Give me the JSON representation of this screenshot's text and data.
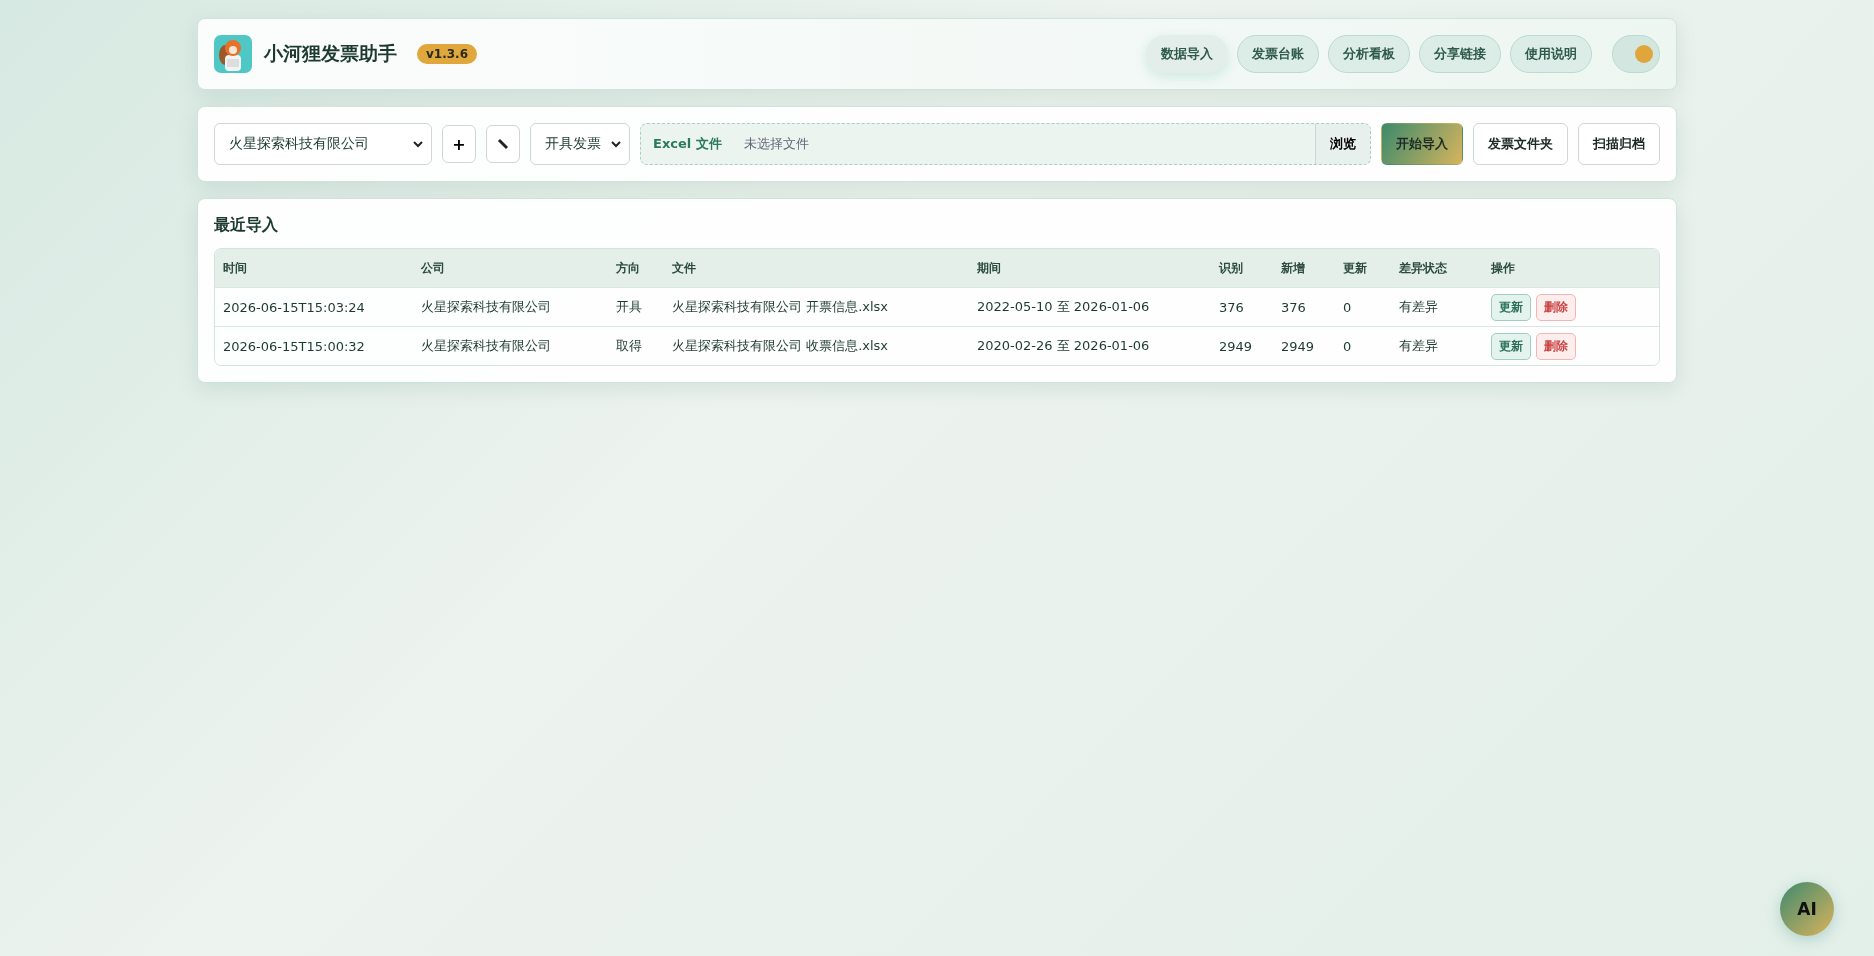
{
  "app": {
    "title": "小河狸发票助手",
    "version": "v1.3.6"
  },
  "nav": [
    {
      "label": "数据导入",
      "selected": true
    },
    {
      "label": "发票台账",
      "selected": false
    },
    {
      "label": "分析看板",
      "selected": false
    },
    {
      "label": "分享链接",
      "selected": false
    },
    {
      "label": "使用说明",
      "selected": false
    }
  ],
  "theme_toggle": {
    "on": true
  },
  "toolbar": {
    "company": "火星探索科技有限公司",
    "add": "+",
    "direction": "开具发票",
    "file_label": "Excel 文件",
    "file_placeholder": "未选择文件",
    "browse": "浏览",
    "buttons": [
      {
        "label": "开始导入",
        "kind": "primary"
      },
      {
        "label": "发票文件夹",
        "kind": "plain"
      },
      {
        "label": "扫描归档",
        "kind": "plain"
      }
    ]
  },
  "recent": {
    "title": "最近导入",
    "columns": [
      "时间",
      "公司",
      "方向",
      "文件",
      "期间",
      "识别",
      "新增",
      "更新",
      "差异状态",
      "操作"
    ],
    "rows": [
      {
        "cells": [
          "2026-06-15T15:03:24",
          "火星探索科技有限公司",
          "开具",
          "火星探索科技有限公司 开票信息.xlsx",
          "2022-05-10 至 2026-01-06",
          "376",
          "376",
          "0",
          "有差异"
        ],
        "actions": [
          {
            "label": "更新",
            "kind": "update"
          },
          {
            "label": "删除",
            "kind": "delete"
          }
        ]
      },
      {
        "cells": [
          "2026-06-15T15:00:32",
          "火星探索科技有限公司",
          "取得",
          "火星探索科技有限公司 收票信息.xlsx",
          "2020-02-26 至 2026-01-06",
          "2949",
          "2949",
          "0",
          "有差异"
        ],
        "actions": [
          {
            "label": "更新",
            "kind": "update"
          },
          {
            "label": "删除",
            "kind": "delete"
          }
        ]
      }
    ]
  },
  "ai_button": "AI"
}
